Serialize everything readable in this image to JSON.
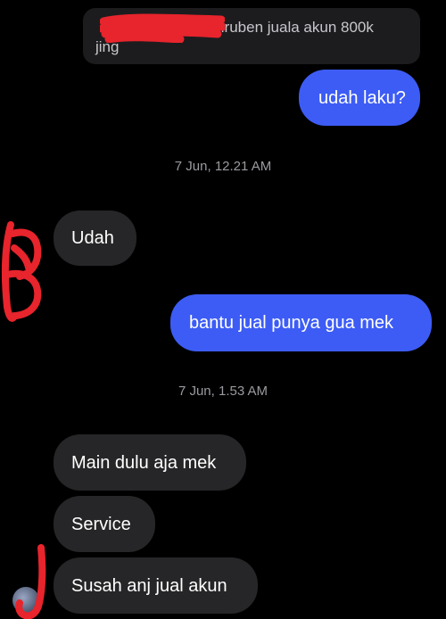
{
  "conversation": {
    "reply_quote": {
      "sender": "",
      "text_line1": ": Siruben juala akun 800k",
      "text_line2": "jing"
    },
    "messages": [
      {
        "id": "m1",
        "direction": "outgoing",
        "text": "udah laku?"
      },
      {
        "id": "ts1",
        "type": "timestamp",
        "text": "7 Jun, 12.21 AM"
      },
      {
        "id": "m2",
        "direction": "incoming",
        "text": "Udah"
      },
      {
        "id": "m3",
        "direction": "outgoing",
        "text": "bantu jual punya gua mek"
      },
      {
        "id": "ts2",
        "type": "timestamp",
        "text": "7 Jun, 1.53 AM"
      },
      {
        "id": "m4",
        "direction": "incoming",
        "text": "Main dulu aja mek"
      },
      {
        "id": "m5",
        "direction": "incoming",
        "text": "Service"
      },
      {
        "id": "m6",
        "direction": "incoming",
        "text": "Susah anj jual akun"
      }
    ]
  },
  "colors": {
    "background": "#000000",
    "outgoing_bubble": "#3d5cf5",
    "incoming_bubble": "#262628",
    "timestamp_text": "#9a9aa0",
    "redaction_marker": "#e8242c"
  },
  "icons": {
    "avatar": "contact-avatar",
    "annotations": "red-marker-scribble"
  }
}
